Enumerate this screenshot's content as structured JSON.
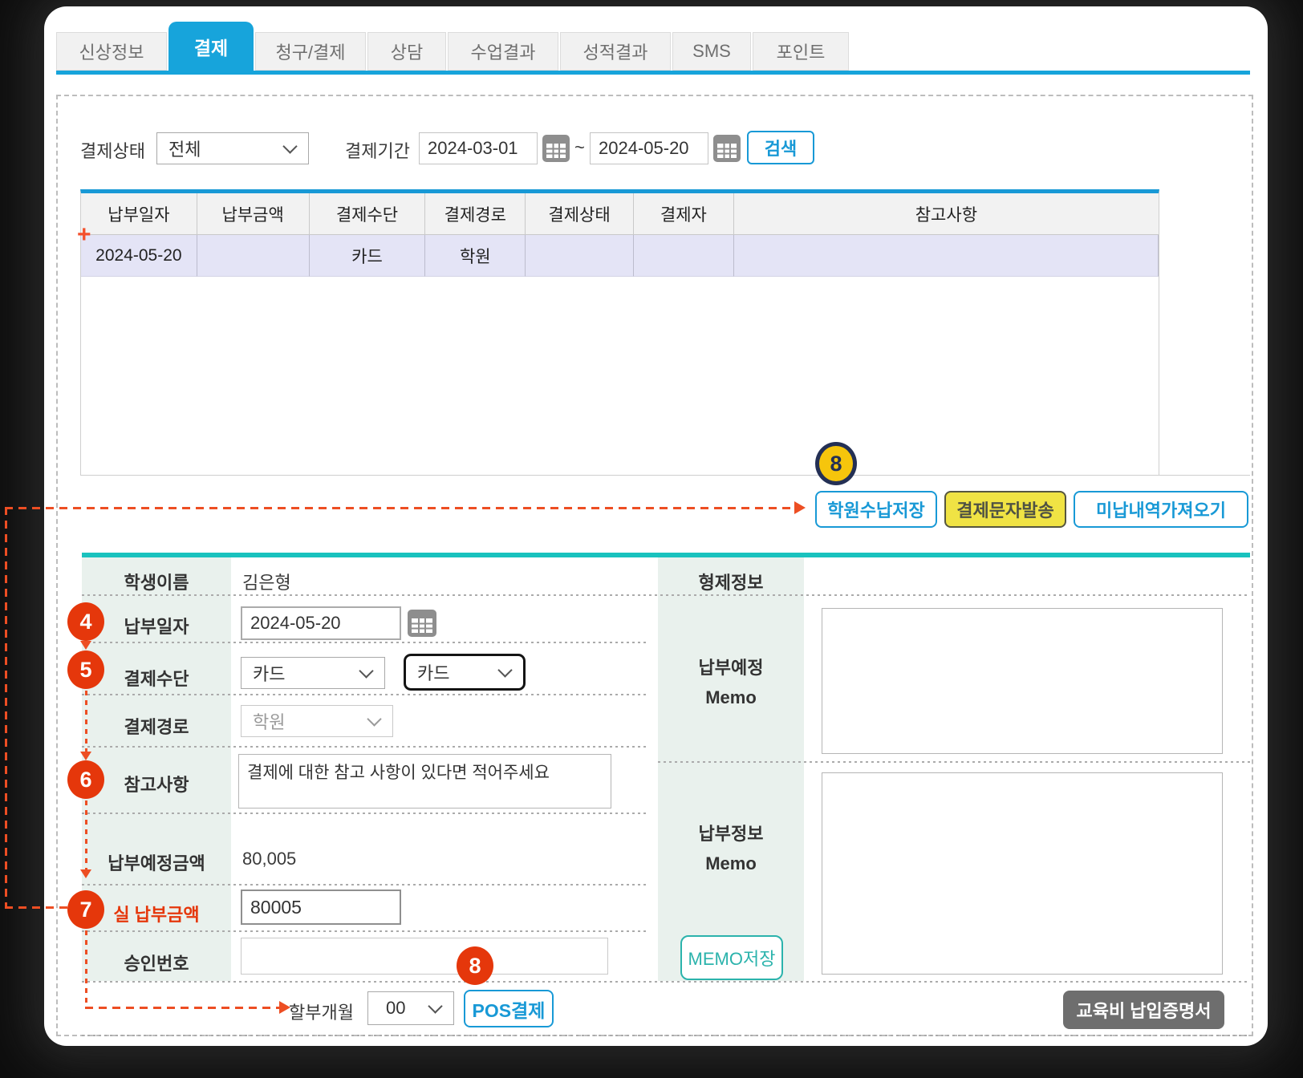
{
  "tabs": {
    "labels": [
      "신상정보",
      "결제",
      "청구/결제",
      "상담",
      "수업결과",
      "성적결과",
      "SMS",
      "포인트"
    ],
    "active": "결제"
  },
  "filter": {
    "status_label": "결제상태",
    "status_value": "전체",
    "period_label": "결제기간",
    "date_from": "2024-03-01",
    "date_separator": "~",
    "date_to": "2024-05-20",
    "search_label": "검색"
  },
  "table": {
    "headers": [
      "납부일자",
      "납부금액",
      "결제수단",
      "결제경로",
      "결제상태",
      "결제자",
      "참고사항"
    ],
    "row": [
      "2024-05-20",
      "",
      "카드",
      "학원",
      "",
      "",
      ""
    ],
    "add_marker": "+"
  },
  "actions": {
    "save_receipt": "학원수납저장",
    "send_sms": "결제문자발송",
    "fetch_unpaid": "미납내역가져오기"
  },
  "form": {
    "student_label": "학생이름",
    "student_name": "김은형",
    "pay_date_label": "납부일자",
    "pay_date": "2024-05-20",
    "method_label": "결제수단",
    "method1": "카드",
    "method2": "카드",
    "route_label": "결제경로",
    "route": "학원",
    "note_label": "참고사항",
    "note_value": "결제에 대한 참고 사항이 있다면 적어주세요",
    "expected_label": "납부예정금액",
    "expected_value": "80,005",
    "actual_label": "실 납부금액",
    "actual_value": "80005",
    "approval_label": "승인번호",
    "installment_label": "할부개월",
    "installment_value": "00",
    "pos_label": "POS결제"
  },
  "memo": {
    "sibling_label": "형제정보",
    "planned_label_line1": "납부예정",
    "planned_label_line2": "Memo",
    "info_label_line1": "납부정보",
    "info_label_line2": "Memo",
    "save_label": "MEMO저장"
  },
  "footer": {
    "certificate": "교육비 납입증명서"
  },
  "steps": {
    "s4": "4",
    "s5": "5",
    "s6": "6",
    "s7": "7",
    "s8_yellow": "8",
    "s8_red": "8"
  },
  "colors": {
    "accent_blue": "#1899D6",
    "tab_blue": "#17A4DB",
    "teal_divider": "#19C2BE",
    "memo_teal": "#2BB3AC",
    "step_red": "#E5370B",
    "step_yellow": "#F6C50C",
    "step_navy": "#243055",
    "row_highlight": "#E4E4F6",
    "button_yellow": "#F0E344",
    "label_column_bg": "#E9F1ED",
    "cert_button_gray": "#6E6E6E"
  }
}
